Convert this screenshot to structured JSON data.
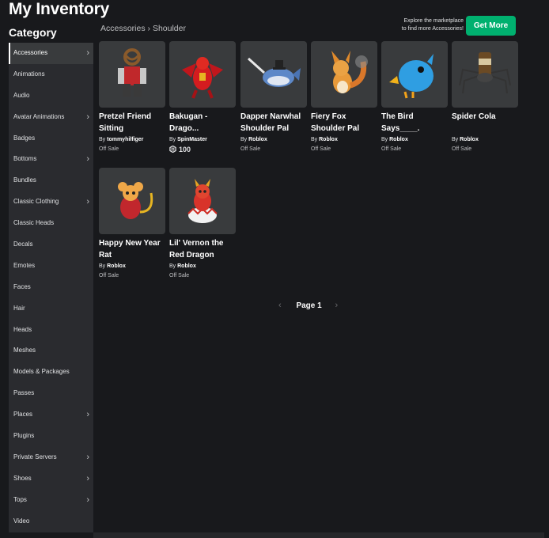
{
  "page": {
    "title": "My Inventory",
    "category_heading": "Category"
  },
  "breadcrumb": {
    "parent": "Accessories",
    "separator": "›",
    "current": "Shoulder"
  },
  "promo": {
    "line1": "Explore the marketplace",
    "line2": "to find more Accessories!",
    "button_label": "Get More",
    "button_color": "#00b06f"
  },
  "sidebar": {
    "items": [
      {
        "label": "Accessories",
        "chevron": "›",
        "active": true
      },
      {
        "label": "Animations",
        "chevron": ""
      },
      {
        "label": "Audio",
        "chevron": ""
      },
      {
        "label": "Avatar Animations",
        "chevron": "›"
      },
      {
        "label": "Badges",
        "chevron": ""
      },
      {
        "label": "Bottoms",
        "chevron": "›"
      },
      {
        "label": "Bundles",
        "chevron": ""
      },
      {
        "label": "Classic Clothing",
        "chevron": "›"
      },
      {
        "label": "Classic Heads",
        "chevron": ""
      },
      {
        "label": "Decals",
        "chevron": ""
      },
      {
        "label": "Emotes",
        "chevron": ""
      },
      {
        "label": "Faces",
        "chevron": ""
      },
      {
        "label": "Hair",
        "chevron": ""
      },
      {
        "label": "Heads",
        "chevron": ""
      },
      {
        "label": "Meshes",
        "chevron": ""
      },
      {
        "label": "Models & Packages",
        "chevron": ""
      },
      {
        "label": "Passes",
        "chevron": ""
      },
      {
        "label": "Places",
        "chevron": "›"
      },
      {
        "label": "Plugins",
        "chevron": ""
      },
      {
        "label": "Private Servers",
        "chevron": "›"
      },
      {
        "label": "Shoes",
        "chevron": "›"
      },
      {
        "label": "Tops",
        "chevron": "›"
      },
      {
        "label": "Video",
        "chevron": ""
      }
    ]
  },
  "items": [
    {
      "name": "Pretzel Friend Sitting",
      "by": "By",
      "creator": "tommyhilfiger",
      "status": "Off Sale",
      "icon": "pretzel-avatar-icon"
    },
    {
      "name": "Bakugan - Drago...",
      "by": "By",
      "creator": "SpinMaster",
      "price": "100",
      "icon": "red-dragon-icon"
    },
    {
      "name": "Dapper Narwhal Shoulder Pal",
      "by": "By",
      "creator": "Roblox",
      "status": "Off Sale",
      "icon": "narwhal-icon"
    },
    {
      "name": "Fiery Fox Shoulder Pal",
      "by": "By",
      "creator": "Roblox",
      "status": "Off Sale",
      "icon": "fox-icon"
    },
    {
      "name": "The Bird Says____.",
      "by": "By",
      "creator": "Roblox",
      "status": "Off Sale",
      "icon": "blue-bird-icon"
    },
    {
      "name": "Spider Cola",
      "by": "By",
      "creator": "Roblox",
      "status": "Off Sale",
      "icon": "spider-cola-icon"
    },
    {
      "name": "Happy New Year Rat",
      "by": "By",
      "creator": "Roblox",
      "status": "Off Sale",
      "icon": "rat-icon"
    },
    {
      "name": "Lil' Vernon the Red Dragon",
      "by": "By",
      "creator": "Roblox",
      "status": "Off Sale",
      "icon": "baby-dragon-icon"
    }
  ],
  "pagination": {
    "label": "Page 1",
    "prev": "‹",
    "next": "›"
  }
}
